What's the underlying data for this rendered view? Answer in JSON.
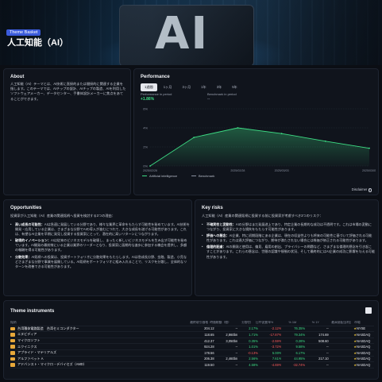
{
  "hero": {
    "badge": "Theme Basket",
    "title": "人工知能（AI）",
    "chip_text": "AI"
  },
  "about": {
    "title": "About",
    "body": "人工知能（AI）テーマとは、AI技術に直接的または間接的に関連する企業を指します。このテーマでは、AIチップの設計、AIチップの製造、AIを利用したソフトウェアメーカー、データセンター、手書体設計メーカーに焦点をあてることができます。"
  },
  "performance": {
    "title": "Performance",
    "tabs": [
      "1週間",
      "1ヶ月",
      "3ヶ月",
      "1年",
      "3年",
      "5年"
    ],
    "active_tab": "1週間",
    "in_period_label": "Performance in period",
    "in_period_value": "+1.86%",
    "benchmark_label": "Benchmark in period",
    "benchmark_value": "--",
    "legend_ai": "Artificial intelligence",
    "legend_bench": "Benchmark",
    "disclaimer": "Disclaimer"
  },
  "chart_data": {
    "type": "area",
    "x": [
      "2025/02/26",
      "2025/02/27",
      "2025/02/28",
      "2025/03/03",
      "2025/03/04",
      "2025/03/05"
    ],
    "xticks": [
      "2025/02/26",
      "2025/02/28",
      "2025/03/03",
      "2025/03/05"
    ],
    "series": [
      {
        "name": "Artificial intelligence",
        "values": [
          0,
          3.0,
          4.0,
          3.4,
          2.6,
          1.86
        ]
      }
    ],
    "yticks": [
      "6%",
      "4%",
      "2%",
      "0%"
    ],
    "ylim": [
      0,
      6
    ],
    "grid": true,
    "legend": "bottom-left",
    "color": "#3ddc84"
  },
  "opportunities": {
    "title": "Opportunities",
    "intro": "投資家が人工知能（AI）産業の関連銘柄へ投資を検討する3つの理由：",
    "items": [
      {
        "head": "高い成長の可能性：",
        "text": "AIは急速に発展している分野であり、様々な業界に革命をもたらす可能性を秘めています。AI技術を開発・応用している企業は、さまざまな分野でAIの導入が進むにつれて、大きな成長を遂げる可能性があります。これは、有望なAI企業を早期に発見し投資する投資家にとって、潜在的に高いリターンにつながります。"
      },
      {
        "head": "破壊的イノベーション：",
        "text": "AIは従来のビジネスモデルを破壊し、まったく新しいビジネスモデルを生み出す可能性を秘めています。AI開発の最前線にいる企業は業界のリーダーとなり、投資家に画期的な進歩に参加する機会を提供し、多額の報酬を得る可能性があります。"
      },
      {
        "head": "分散効果：",
        "text": "AI銘柄への投資は、投資ポートフォリオに分散効果をもたらします。AIは急成長分野、金融、製造、小売などさまざまな分野で事業を展開している。AI銘柄をポートフォリオに組み入れることで、リスクを分散し、全体的なリターンを改善できる可能性があります。"
      }
    ]
  },
  "risks": {
    "title": "Key risks",
    "intro": "人工知能（AI）産業の関連銘柄に投資する前に投資家が考慮すべき3つのリスク：",
    "items": [
      {
        "head": "不確実性と変動性：",
        "text": "AIの分野はまだ発展途上であり、特定企業の長期的な成功は不透明です。これは市場の変動につながり、投資家に大きな損失をもたらす可能性があります。"
      },
      {
        "head": "評価への懸念：",
        "text": "AI企業、特に初期段階にある企業は、現在の収益性よりも将来の可能性に基づいて評価される可能性があります。これは過大評価につながり、期待が満たされない場合には株価が修正される可能性があります。"
      },
      {
        "head": "倫理的配慮：",
        "text": "AIの開発と使用は、偏見、雇用の創出、プライバシーの問題など、さまざまな倫理的懸念を引き起こすことがあります。これらの懸念は、世間の認識や規制の状況、そして最終的にはAI企業の成功に影響を与える可能性があります。"
      }
    ]
  },
  "instruments": {
    "title": "Theme instruments",
    "headers": [
      "銘柄",
      "最終取引価格",
      "時価総額（億）",
      "分野別",
      "日中変動率%",
      "% 1M",
      "% 1Y",
      "最高値",
      "配当利回",
      "市場"
    ],
    "rows": [
      {
        "name": "台湾積体電路製造　台湾セミコンダクター",
        "price": "204.12",
        "cap": "--",
        "d": "2.17%",
        "m": "-2.12%",
        "y": "76.35%",
        "hi": "--",
        "div": "",
        "mkt": "NYSE",
        "star": "★"
      },
      {
        "name": "エヌビディア",
        "price": "118.65",
        "cap": "2,860bn",
        "d": "1.71%",
        "m": "-17.87%",
        "y": "79.34%",
        "hi": "174.69",
        "div": "",
        "mkt": "NASDAQ",
        "star": "★"
      },
      {
        "name": "マイクロソフト",
        "price": "412.37",
        "cap": "3,050bn",
        "d": "0.35%",
        "m": "-2.59%",
        "y": "0.28%",
        "hi": "508.60",
        "div": "",
        "mkt": "NASDAQ",
        "star": "★"
      },
      {
        "name": "エクイニクス",
        "price": "924.28",
        "cap": "--",
        "d": "1.01%",
        "m": "-3.72%",
        "y": "9.58%",
        "hi": "--",
        "div": "",
        "mkt": "NASDAQ",
        "star": "★"
      },
      {
        "name": "アプライド・マテリアルズ",
        "price": "178.56",
        "cap": "--",
        "d": "-0.13%",
        "m": "5.00%",
        "y": "6.17%",
        "hi": "--",
        "div": "",
        "mkt": "NASDAQ",
        "star": "★"
      },
      {
        "name": "アルファベット A",
        "price": "206.38",
        "cap": "2,460bn",
        "d": "2.56%",
        "m": "7.61%",
        "y": "44.95%",
        "hi": "217.10",
        "div": "",
        "mkt": "NASDAQ",
        "star": "★"
      },
      {
        "name": "アドバンスト・マイクロ・デバイセズ（AMD）",
        "price": "119.50",
        "cap": "--",
        "d": "4.58%",
        "m": "-4.69%",
        "y": "-32.74%",
        "hi": "--",
        "div": "",
        "mkt": "NASDAQ",
        "star": "★"
      }
    ]
  }
}
